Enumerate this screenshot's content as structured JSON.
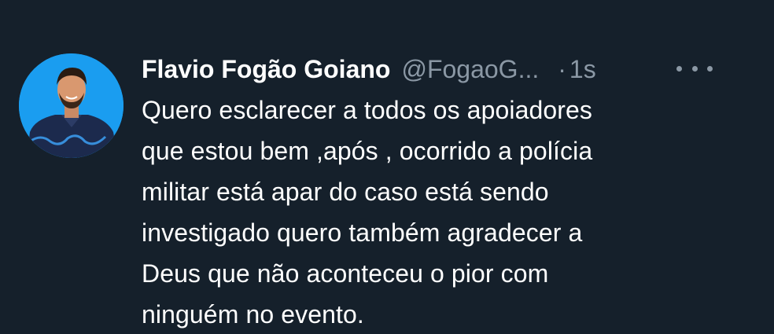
{
  "tweet": {
    "author_name": "Flavio Fogão Goiano",
    "handle": "@FogaoG...",
    "separator": "·",
    "time": "1s",
    "more_icon": "more-horizontal-icon",
    "text": "Quero esclarecer a todos os apoiadores\nque estou bem ,após , ocorrido a polícia\nmilitar está apar do caso está sendo\ninvestigado quero também agradecer a\nDeus que não aconteceu o pior com\nninguém no evento."
  },
  "colors": {
    "background": "#15202b",
    "text_primary": "#ffffff",
    "text_secondary": "#8b98a5",
    "avatar_bg": "#1a9df0"
  }
}
